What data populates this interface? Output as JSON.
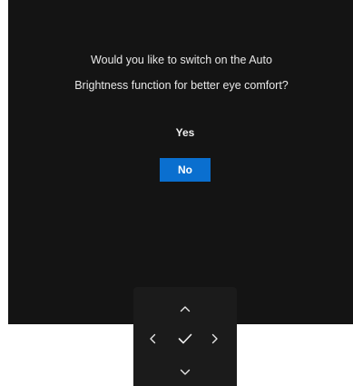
{
  "dialog": {
    "line1": "Would you like to switch on the Auto",
    "line2": "Brightness function for better eye comfort?",
    "yes_label": "Yes",
    "no_label": "No",
    "selected": "No"
  },
  "navpad": {
    "buttons": [
      "up-icon",
      "left-icon",
      "check-icon",
      "right-icon",
      "down-icon"
    ]
  },
  "colors": {
    "screen_bg": "#141414",
    "navpad_bg": "#1b1b1b",
    "selection": "#0a6fcf"
  }
}
